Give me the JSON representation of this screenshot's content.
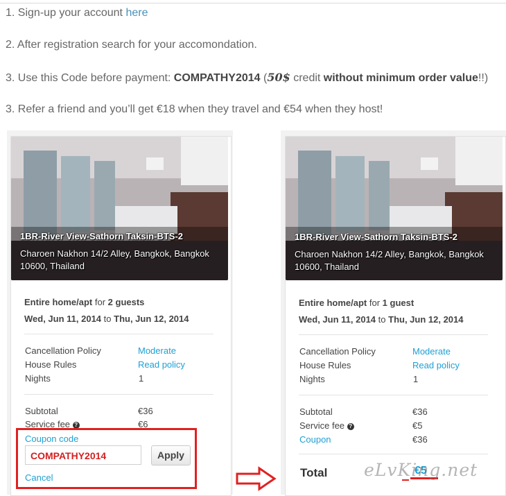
{
  "steps": {
    "s1_text": "1. Sign-up your account ",
    "s1_link": "here",
    "s2_text": "2. After registration search for your accomondation.",
    "s3_pre": "3. Use this Code before payment: ",
    "s3_code": "COMPATHY2014",
    "s3_mid1": " (",
    "s3_amount": "50$",
    "s3_mid2": " credit ",
    "s3_bold": "without minimum order value",
    "s3_post": "!!)",
    "s4_text": "3. Refer a friend and you’ll get €18 when they travel and €54 when they host!"
  },
  "left_card": {
    "listing_title": "1BR-River View-Sathorn Taksin-BTS-2",
    "address": "Charoen Nakhon 14/2 Alley, Bangkok, Bangkok 10600, Thailand",
    "room_type": "Entire home/apt",
    "for_word": " for ",
    "guests": "2 guests",
    "checkin": "Wed, Jun 11, 2014",
    "to_word": " to ",
    "checkout": "Thu, Jun 12, 2014",
    "cancellation_label": "Cancellation Policy",
    "cancellation_value": "Moderate",
    "house_rules_label": "House Rules",
    "house_rules_value": "Read policy",
    "nights_label": "Nights",
    "nights_value": "1",
    "subtotal_label": "Subtotal",
    "subtotal_value": "€36",
    "service_fee_label": "Service fee",
    "service_fee_value": "€6",
    "coupon_link": "Coupon code",
    "coupon_value": "COMPATHY2014",
    "apply_label": "Apply",
    "cancel_link": "Cancel"
  },
  "right_card": {
    "listing_title": "1BR-River View-Sathorn Taksin-BTS-2",
    "address": "Charoen Nakhon 14/2 Alley, Bangkok, Bangkok 10600, Thailand",
    "room_type": "Entire home/apt",
    "for_word": " for ",
    "guests": "1 guest",
    "checkin": "Wed, Jun 11, 2014",
    "to_word": " to ",
    "checkout": "Thu, Jun 12, 2014",
    "cancellation_label": "Cancellation Policy",
    "cancellation_value": "Moderate",
    "house_rules_label": "House Rules",
    "house_rules_value": "Read policy",
    "nights_label": "Nights",
    "nights_value": "1",
    "subtotal_label": "Subtotal",
    "subtotal_value": "€36",
    "service_fee_label": "Service fee",
    "service_fee_value": "€5",
    "coupon_label": "Coupon",
    "coupon_value": "€36",
    "total_label": "Total",
    "total_value": "€5"
  },
  "watermark": "eLvKing.net",
  "colors": {
    "link": "#1ea0d4",
    "highlight": "#e02020",
    "code_text": "#d42020"
  },
  "icons": [
    "question-circle-icon",
    "right-arrow-icon"
  ]
}
